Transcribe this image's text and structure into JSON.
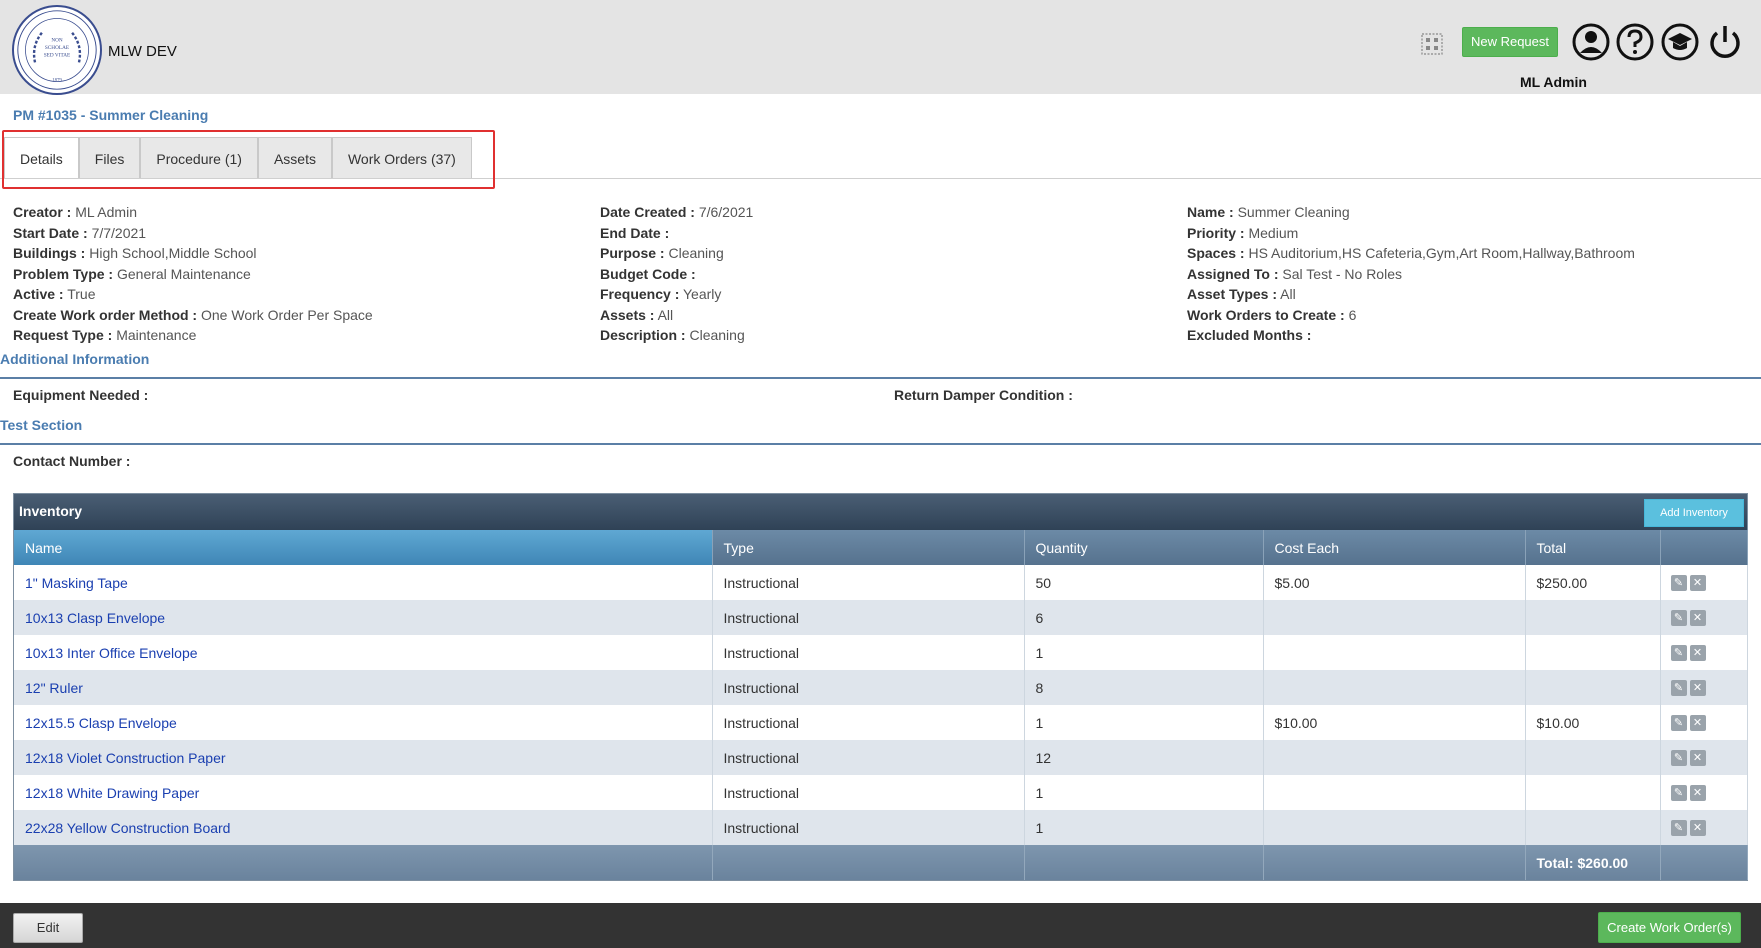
{
  "header": {
    "app_title": "MLW DEV",
    "logo_text": [
      "NON",
      "SCHOLAE",
      "SED VITAE",
      "1879"
    ],
    "new_request_label": "New Request",
    "user_name": "ML Admin"
  },
  "page": {
    "title": "PM #1035 - Summer Cleaning"
  },
  "tabs": [
    {
      "label": "Details",
      "active": true
    },
    {
      "label": "Files"
    },
    {
      "label": "Procedure (1)"
    },
    {
      "label": "Assets"
    },
    {
      "label": "Work Orders (37)"
    }
  ],
  "details": {
    "col1": [
      {
        "label": "Creator :",
        "value": "ML Admin"
      },
      {
        "label": "Start Date :",
        "value": "7/7/2021"
      },
      {
        "label": "Buildings :",
        "value": "High School,Middle School"
      },
      {
        "label": "Problem Type :",
        "value": "General Maintenance"
      },
      {
        "label": "Active :",
        "value": "True"
      },
      {
        "label": "Create Work order Method :",
        "value": "One Work Order Per Space"
      },
      {
        "label": "Request Type :",
        "value": "Maintenance"
      }
    ],
    "col2": [
      {
        "label": "Date Created :",
        "value": "7/6/2021"
      },
      {
        "label": "End Date :",
        "value": ""
      },
      {
        "label": "Purpose :",
        "value": "Cleaning"
      },
      {
        "label": "Budget Code :",
        "value": ""
      },
      {
        "label": "Frequency :",
        "value": "Yearly"
      },
      {
        "label": "Assets :",
        "value": "All"
      },
      {
        "label": "Description :",
        "value": "Cleaning"
      }
    ],
    "col3": [
      {
        "label": "Name :",
        "value": "Summer Cleaning"
      },
      {
        "label": "Priority :",
        "value": "Medium"
      },
      {
        "label": "Spaces :",
        "value": "HS Auditorium,HS Cafeteria,Gym,Art Room,Hallway,Bathroom"
      },
      {
        "label": "Assigned To :",
        "value": "Sal Test - No Roles"
      },
      {
        "label": "Asset Types :",
        "value": "All"
      },
      {
        "label": "Work Orders to Create :",
        "value": "6"
      },
      {
        "label": "Excluded Months :",
        "value": ""
      }
    ]
  },
  "additional": {
    "heading": "Additional Information",
    "equipment_label": "Equipment Needed :",
    "damper_label": "Return Damper Condition :"
  },
  "test_section": {
    "heading": "Test Section",
    "contact_label": "Contact Number :"
  },
  "inventory": {
    "title": "Inventory",
    "add_label": "Add Inventory",
    "columns": [
      "Name",
      "Type",
      "Quantity",
      "Cost Each",
      "Total"
    ],
    "rows": [
      {
        "name": "1\" Masking Tape",
        "type": "Instructional",
        "quantity": "50",
        "cost": "$5.00",
        "total": "$250.00"
      },
      {
        "name": "10x13 Clasp Envelope",
        "type": "Instructional",
        "quantity": "6",
        "cost": "",
        "total": ""
      },
      {
        "name": "10x13 Inter Office Envelope",
        "type": "Instructional",
        "quantity": "1",
        "cost": "",
        "total": ""
      },
      {
        "name": "12\" Ruler",
        "type": "Instructional",
        "quantity": "8",
        "cost": "",
        "total": ""
      },
      {
        "name": "12x15.5 Clasp Envelope",
        "type": "Instructional",
        "quantity": "1",
        "cost": "$10.00",
        "total": "$10.00"
      },
      {
        "name": "12x18 Violet Construction Paper",
        "type": "Instructional",
        "quantity": "12",
        "cost": "",
        "total": ""
      },
      {
        "name": "12x18 White Drawing Paper",
        "type": "Instructional",
        "quantity": "1",
        "cost": "",
        "total": ""
      },
      {
        "name": "22x28 Yellow Construction Board",
        "type": "Instructional",
        "quantity": "1",
        "cost": "",
        "total": ""
      }
    ],
    "footer_total": "Total: $260.00"
  },
  "footer": {
    "edit_label": "Edit",
    "create_label": "Create Work Order(s)"
  },
  "colors": {
    "accent_blue": "#4a7cb0",
    "success_green": "#5cb85c",
    "info_blue": "#5bc0de",
    "link_blue": "#1a3fb0",
    "highlight_red": "#e03030"
  }
}
